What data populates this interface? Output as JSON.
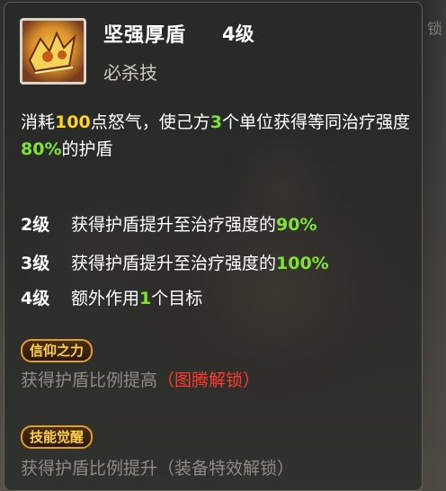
{
  "skill": {
    "name": "坚强厚盾",
    "level": "4级",
    "type": "必杀技"
  },
  "description": {
    "part1": "消耗",
    "rage": "100",
    "part2": "点怒气，使己方",
    "units": "3",
    "part3": "个单位获得等同治疗强度",
    "percent": "80%",
    "part4": "的护盾"
  },
  "levels": [
    {
      "label": "2级",
      "text": "获得护盾提升至治疗强度的",
      "value": "90%"
    },
    {
      "label": "3级",
      "text": "获得护盾提升至治疗强度的",
      "value": "100%"
    },
    {
      "label": "4级",
      "text_a": "额外作用",
      "value": "1",
      "text_b": "个目标"
    }
  ],
  "faith": {
    "badge": "信仰之力",
    "text": "获得护盾比例提高",
    "unlock": "（图腾解锁）"
  },
  "awaken": {
    "badge": "技能觉醒",
    "text": "获得护盾比例提升（装备特效解锁）"
  },
  "side_tab": "锁",
  "colors": {
    "highlight_yellow": "#ffd21f",
    "highlight_green": "#7fe23a",
    "unlock_red": "#ff3b2a",
    "badge_orange": "#e39d2c"
  }
}
